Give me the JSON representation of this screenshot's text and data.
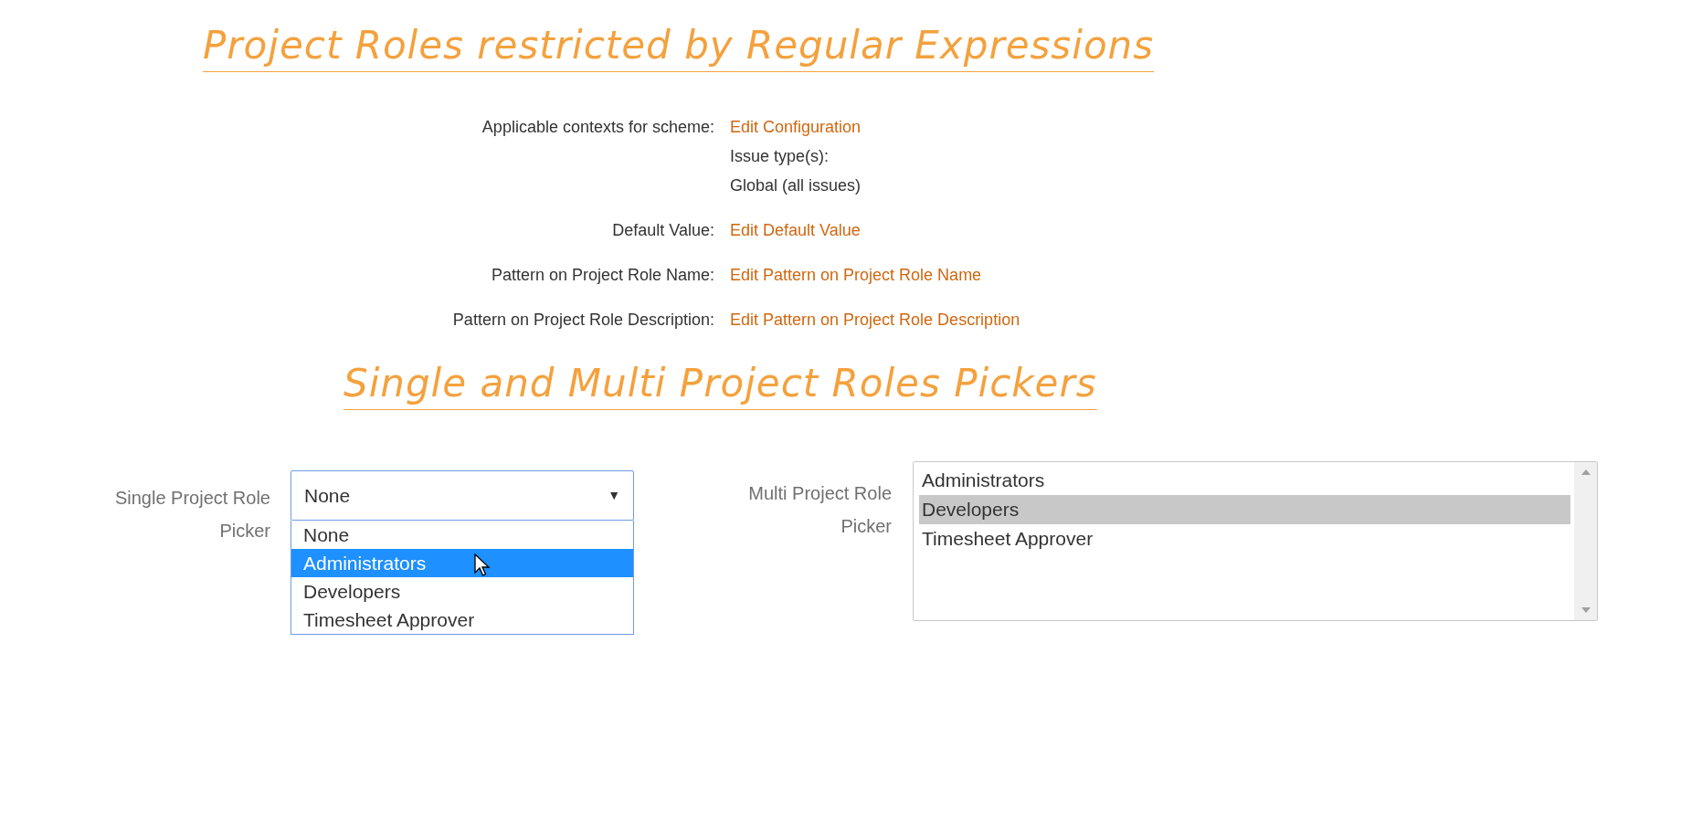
{
  "heading_1": "Project Roles restricted by Regular Expressions",
  "config_rows": [
    {
      "label": "Applicable contexts for scheme:",
      "link": "Edit Configuration",
      "notes": [
        "Issue type(s):",
        "Global (all issues)"
      ]
    },
    {
      "label": "Default Value:",
      "link": "Edit Default Value"
    },
    {
      "label": "Pattern on Project Role Name:",
      "link": "Edit Pattern on Project Role Name"
    },
    {
      "label": "Pattern on Project Role Description:",
      "link": "Edit Pattern on Project Role Description"
    }
  ],
  "heading_2": "Single and Multi Project Roles Pickers",
  "single_picker": {
    "label": "Single Project Role Picker",
    "value": "None",
    "caret": "▼",
    "expanded": true,
    "options": [
      {
        "label": "None",
        "highlighted": false
      },
      {
        "label": "Administrators",
        "highlighted": true
      },
      {
        "label": "Developers",
        "highlighted": false
      },
      {
        "label": "Timesheet Approver",
        "highlighted": false
      }
    ]
  },
  "multi_picker": {
    "label": "Multi Project Role Picker",
    "options": [
      {
        "label": "Administrators",
        "selected": false
      },
      {
        "label": "Developers",
        "selected": true
      },
      {
        "label": "Timesheet Approver",
        "selected": false
      }
    ]
  }
}
